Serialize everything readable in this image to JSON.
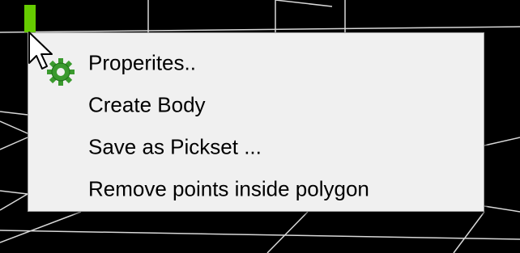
{
  "scene": {
    "background_color": "#000000",
    "grid_color": "#d8d8d8",
    "marker_color": "#66cc00"
  },
  "context_menu": {
    "items": [
      {
        "label": "Properites..",
        "icon": "gear-icon"
      },
      {
        "label": "Create Body"
      },
      {
        "label": "Save as Pickset ..."
      },
      {
        "label": "Remove points inside polygon"
      }
    ]
  },
  "pointer": {
    "icon": "mouse-pointer-icon"
  }
}
